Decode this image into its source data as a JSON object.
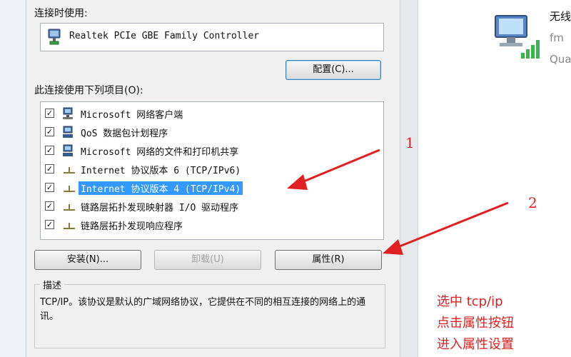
{
  "dialog": {
    "connect_using_label": "连接时使用:",
    "adapter_name": "Realtek PCIe GBE Family Controller",
    "configure_button": "配置(C)...",
    "items_label": "此连接使用下列项目(O):",
    "items": [
      {
        "label": "Microsoft 网络客户端",
        "checked": true,
        "icon": "network-client-icon",
        "selected": false
      },
      {
        "label": "QoS 数据包计划程序",
        "checked": true,
        "icon": "qos-scheduler-icon",
        "selected": false
      },
      {
        "label": "Microsoft 网络的文件和打印机共享",
        "checked": true,
        "icon": "file-printer-share-icon",
        "selected": false
      },
      {
        "label": "Internet 协议版本 6 (TCP/IPv6)",
        "checked": true,
        "icon": "protocol-icon",
        "selected": false
      },
      {
        "label": "Internet 协议版本 4 (TCP/IPv4)",
        "checked": true,
        "icon": "protocol-icon",
        "selected": true
      },
      {
        "label": "链路层拓扑发现映射器 I/O 驱动程序",
        "checked": true,
        "icon": "protocol-icon",
        "selected": false
      },
      {
        "label": "链路层拓扑发现响应程序",
        "checked": true,
        "icon": "protocol-icon",
        "selected": false
      }
    ],
    "install_button": "安装(N)...",
    "uninstall_button": "卸载(U)",
    "properties_button": "属性(R)",
    "description_title": "描述",
    "description_text": "TCP/IP。该协议是默认的广域网络协议，它提供在不同的相互连接的网络上的通讯。"
  },
  "annotations": {
    "marker_1": "1",
    "marker_2": "2",
    "note_lines": [
      "选中 tcp/ip",
      "点击属性按钮",
      "进入属性设置"
    ],
    "color": "#e02020"
  },
  "right_panel": {
    "line1": "无线",
    "line2": "fm",
    "line3": "Qua"
  },
  "colors": {
    "selection": "#3399ff",
    "dialog_bg": "#f0f0f0"
  }
}
